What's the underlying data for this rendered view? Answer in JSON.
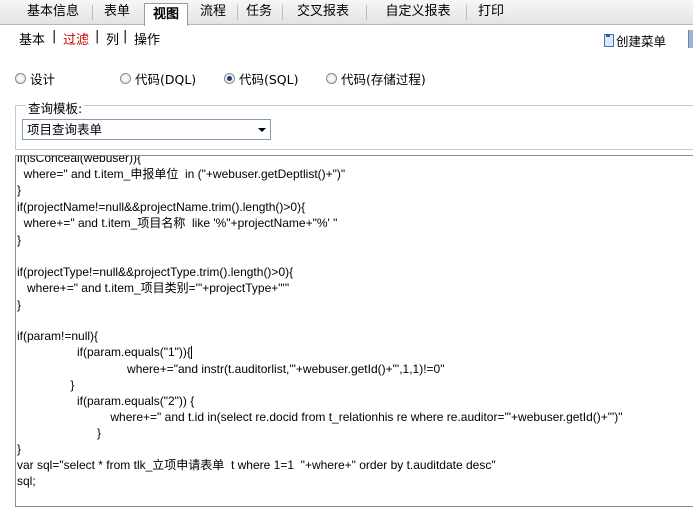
{
  "tabs": [
    "基本信息",
    "表单",
    "视图",
    "流程",
    "任务",
    "交叉报表",
    "自定义报表",
    "打印"
  ],
  "subtabs": [
    "基本",
    "过滤",
    "列",
    "操作"
  ],
  "create_menu": "创建菜单",
  "radio_options": [
    "设计",
    "代码(DQL)",
    "代码(SQL)",
    "代码(存储过程)"
  ],
  "selected_radio": "代码(SQL)",
  "query_template_label": "查询模板:",
  "query_template_value": "项目查询表单",
  "code_lines": [
    "if(isConceal(webuser)){",
    "  where=\" and t.item_申报单位  in (\"+webuser.getDeptlist()+\")\"",
    "}",
    "if(projectName!=null&&projectName.trim().length()>0){",
    "  where+=\" and t.item_项目名称  like '%\"+projectName+\"%' \"",
    "}",
    "",
    "if(projectType!=null&&projectType.trim().length()>0){",
    "   where+=\" and t.item_项目类别='\"+projectType+\"'\"",
    "}",
    "",
    "if(param!=null){",
    "                  if(param.equals(\"1\")){",
    "                                 where+=\"and instr(t.auditorlist,'\"+webuser.getId()+\"',1,1)!=0\"",
    "                }",
    "                  if(param.equals(\"2\")) {",
    "                            where+=\" and t.id in(select re.docid from t_relationhis re where re.auditor='\"+webuser.getId()+\"')\"",
    "                        }",
    "}",
    "var sql=\"select * from tlk_立项申请表单  t where 1=1  \"+where+\" order by t.auditdate desc\"",
    "sql;"
  ]
}
